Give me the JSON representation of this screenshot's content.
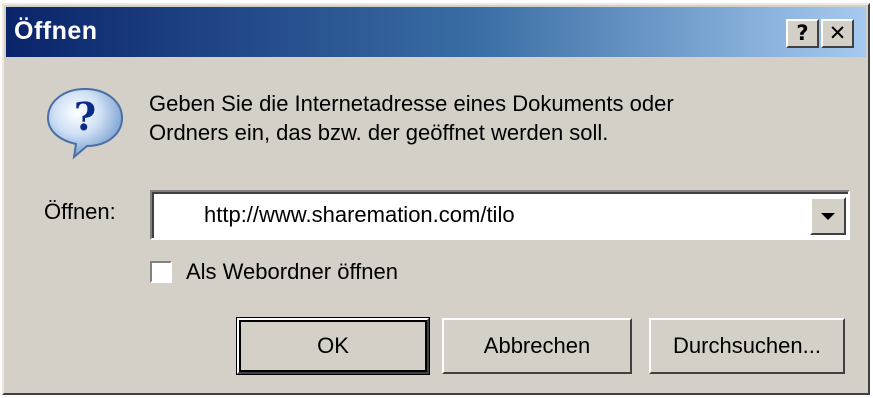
{
  "window": {
    "title": "Öffnen",
    "help_glyph": "?",
    "close_glyph": "✕"
  },
  "icon": {
    "name": "question-icon",
    "glyph": "?"
  },
  "message": {
    "line1": "Geben Sie die Internetadresse eines Dokuments oder",
    "line2": "Ordners ein, das bzw. der geöffnet werden soll."
  },
  "open_field": {
    "label": "Öffnen:",
    "value": "http://www.sharemation.com/tilo"
  },
  "webfolder_checkbox": {
    "label": "Als Webordner öffnen",
    "checked": false
  },
  "buttons": {
    "ok": "OK",
    "cancel": "Abbrechen",
    "browse": "Durchsuchen..."
  }
}
